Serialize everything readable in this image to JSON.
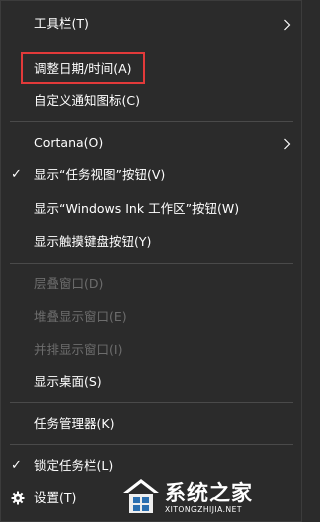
{
  "menu": {
    "items": [
      {
        "label": "工具栏(T)",
        "submenu": true
      },
      {
        "label": "调整日期/时间(A)",
        "highlighted": true
      },
      {
        "label": "自定义通知图标(C)"
      },
      {
        "label": "Cortana(O)",
        "submenu": true
      },
      {
        "label": "显示“任务视图”按钮(V)",
        "checked": true
      },
      {
        "label": "显示“Windows Ink 工作区”按钮(W)"
      },
      {
        "label": "显示触摸键盘按钮(Y)"
      },
      {
        "label": "层叠窗口(D)",
        "disabled": true
      },
      {
        "label": "堆叠显示窗口(E)",
        "disabled": true
      },
      {
        "label": "并排显示窗口(I)",
        "disabled": true
      },
      {
        "label": "显示桌面(S)"
      },
      {
        "label": "任务管理器(K)"
      },
      {
        "label": "锁定任务栏(L)",
        "checked": true
      },
      {
        "label": "设置(T)",
        "icon": "gear-icon"
      }
    ],
    "check_glyph": "✓"
  },
  "watermark": {
    "title": "系统之家",
    "url": "XITONGZHIJIA.NET"
  },
  "colors": {
    "background": "#2b2b2b",
    "text": "#ffffff",
    "disabled_text": "#6d6d6d",
    "separator": "#4a4a4a",
    "highlight_border": "#e23a3a"
  }
}
